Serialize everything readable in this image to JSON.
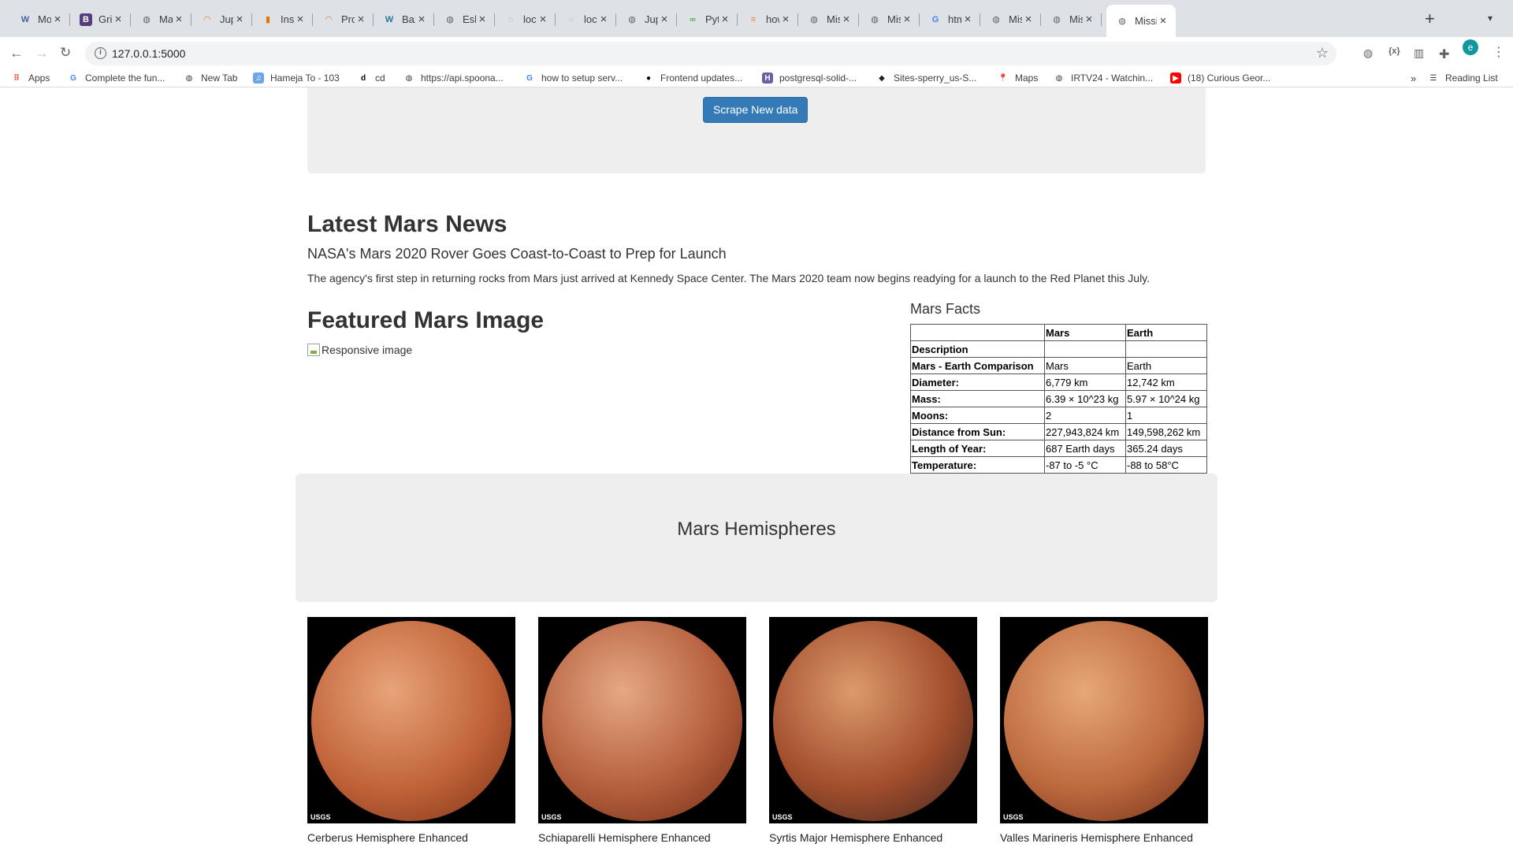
{
  "browser": {
    "tabs": [
      {
        "title": "Modu",
        "icon": "W",
        "color": "#4a5ea8"
      },
      {
        "title": "Grid",
        "icon": "B",
        "color": "#563d7c"
      },
      {
        "title": "Mars",
        "icon": "globe",
        "color": "#5f6368"
      },
      {
        "title": "Jupyt",
        "icon": "jupyter",
        "color": "#f37626"
      },
      {
        "title": "Ins_M",
        "icon": "book",
        "color": "#e8710a"
      },
      {
        "title": "Progr",
        "icon": "jupyter",
        "color": "#f37626"
      },
      {
        "title": "Bazie",
        "icon": "W",
        "color": "#21759b"
      },
      {
        "title": "Eshg",
        "icon": "globe",
        "color": "#5f6368"
      },
      {
        "title": "local",
        "icon": "loading",
        "color": "#9aa0a6"
      },
      {
        "title": "local",
        "icon": "loading",
        "color": "#9aa0a6"
      },
      {
        "title": "Jupyt",
        "icon": "globe",
        "color": "#5f6368"
      },
      {
        "title": "Pytho",
        "icon": "python",
        "color": "#4caf50"
      },
      {
        "title": "how",
        "icon": "stack",
        "color": "#f48024"
      },
      {
        "title": "Missi",
        "icon": "globe",
        "color": "#5f6368"
      },
      {
        "title": "Missi",
        "icon": "globe",
        "color": "#5f6368"
      },
      {
        "title": "html",
        "icon": "G",
        "color": "#4285f4"
      },
      {
        "title": "Missi",
        "icon": "globe",
        "color": "#5f6368"
      },
      {
        "title": "Missi",
        "icon": "globe",
        "color": "#5f6368"
      },
      {
        "title": "Missi",
        "icon": "globe",
        "color": "#5f6368"
      }
    ],
    "active_tab_index": 18,
    "url": "127.0.0.1:5000",
    "profile_initial": "e",
    "bookmarks": [
      {
        "label": "Apps",
        "icon": "apps"
      },
      {
        "label": "Complete the fun...",
        "icon": "G"
      },
      {
        "label": "New Tab",
        "icon": "globe"
      },
      {
        "label": "Hameja To - 103",
        "icon": "music"
      },
      {
        "label": "cd",
        "icon": "d"
      },
      {
        "label": "https://api.spoona...",
        "icon": "globe"
      },
      {
        "label": "how to setup serv...",
        "icon": "G"
      },
      {
        "label": "Frontend updates...",
        "icon": "github"
      },
      {
        "label": "postgresql-solid-...",
        "icon": "heroku"
      },
      {
        "label": "Sites-sperry_us-S...",
        "icon": "diamond"
      },
      {
        "label": "Maps",
        "icon": "maps"
      },
      {
        "label": "IRTV24 - Watchin...",
        "icon": "globe"
      },
      {
        "label": "(18) Curious Geor...",
        "icon": "youtube"
      }
    ],
    "reading_list": "Reading List"
  },
  "page": {
    "scrape_button": "Scrape New data",
    "news": {
      "heading": "Latest Mars News",
      "title": "NASA's Mars 2020 Rover Goes Coast-to-Coast to Prep for Launch",
      "paragraph": "The agency's first step in returning rocks from Mars just arrived at Kennedy Space Center. The Mars 2020 team now begins readying for a launch to the Red Planet this July."
    },
    "featured": {
      "heading": "Featured Mars Image",
      "alt": "Responsive image"
    },
    "facts": {
      "heading": "Mars Facts",
      "columns": [
        "",
        "Mars",
        "Earth"
      ],
      "rows": [
        [
          "Description",
          "",
          ""
        ],
        [
          "Mars - Earth Comparison",
          "Mars",
          "Earth"
        ],
        [
          "Diameter:",
          "6,779 km",
          "12,742 km"
        ],
        [
          "Mass:",
          "6.39 × 10^23 kg",
          "5.97 × 10^24 kg"
        ],
        [
          "Moons:",
          "2",
          "1"
        ],
        [
          "Distance from Sun:",
          "227,943,824 km",
          "149,598,262 km"
        ],
        [
          "Length of Year:",
          "687 Earth days",
          "365.24 days"
        ],
        [
          "Temperature:",
          "-87 to -5 °C",
          "-88 to 58°C"
        ]
      ]
    },
    "hemispheres": {
      "heading": "Mars Hemispheres",
      "items": [
        {
          "title": "Cerberus Hemisphere Enhanced",
          "logo": "USGS",
          "colors": [
            "#e8a47a",
            "#c2643a",
            "#7a2f16"
          ]
        },
        {
          "title": "Schiaparelli Hemisphere Enhanced",
          "logo": "USGS",
          "colors": [
            "#e6a884",
            "#b5603d",
            "#6e2a14"
          ]
        },
        {
          "title": "Syrtis Major Hemisphere Enhanced",
          "logo": "USGS",
          "colors": [
            "#dc9a6c",
            "#a24e2c",
            "#3a2420"
          ]
        },
        {
          "title": "Valles Marineris Hemisphere Enhanced",
          "logo": "USGS",
          "colors": [
            "#e7a878",
            "#bd6a3f",
            "#6d2c15"
          ]
        }
      ]
    }
  }
}
